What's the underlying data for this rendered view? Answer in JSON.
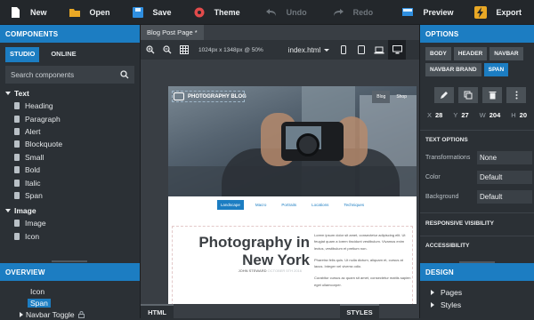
{
  "toolbar": {
    "new": "New",
    "open": "Open",
    "save": "Save",
    "theme": "Theme",
    "undo": "Undo",
    "redo": "Redo",
    "preview": "Preview",
    "export": "Export"
  },
  "components": {
    "header": "COMPONENTS",
    "tabs": [
      "STUDIO",
      "ONLINE"
    ],
    "search_placeholder": "Search components",
    "categories": [
      {
        "name": "Text",
        "items": [
          "Heading",
          "Paragraph",
          "Alert",
          "Blockquote",
          "Small",
          "Bold",
          "Italic",
          "Span"
        ]
      },
      {
        "name": "Image",
        "items": [
          "Image",
          "Icon"
        ]
      }
    ]
  },
  "overview": {
    "header": "OVERVIEW",
    "items": [
      "Icon",
      "Span",
      "Navbar Toggle"
    ]
  },
  "center": {
    "page_tab": "Blog Post Page *",
    "dimensions": "1024px x 1348px @ 50%",
    "file": "index.html",
    "bottom_html": "HTML",
    "bottom_styles": "STYLES"
  },
  "preview": {
    "brand": "PHOTOGRAPHY BLOG",
    "nav": [
      "Blog",
      "Shop"
    ],
    "subnav": [
      "Landscape",
      "Macro",
      "Portraits",
      "Locations",
      "Techniques"
    ],
    "title_line1": "Photography in",
    "title_line2": "New York",
    "author": "JOHN STEWARD",
    "date": "OCTOBER 5TH 2016",
    "body": [
      "Lorem ipsum dolor sit amet, consectetur adipiscing elit. Ut feugiat quam a lorem tincidunt vestibulum. Vivamus enim lectus, vestibulum et pretium non.",
      "Pharetra felis quis. Ut nulla dictum, aliquam et, cursus at lacus. Integer vel viverra odio.",
      "Curabitur cursus ac quam sit amet, consectetur mattis sapien eget ullamcorper."
    ]
  },
  "options": {
    "header": "OPTIONS",
    "tags": [
      "BODY",
      "HEADER",
      "NAVBAR",
      "NAVBAR BRAND",
      "SPAN"
    ],
    "x": "28",
    "y": "27",
    "w": "204",
    "h": "20",
    "text_options_label": "TEXT OPTIONS",
    "transformations_label": "Transformations",
    "transformations_value": "None",
    "color_label": "Color",
    "color_value": "Default",
    "background_label": "Background",
    "background_value": "Default",
    "responsive_label": "RESPONSIVE VISIBILITY",
    "accessibility_label": "ACCESSIBILITY"
  },
  "design": {
    "header": "DESIGN",
    "items": [
      "Pages",
      "Styles"
    ]
  },
  "colors": {
    "accent": "#1c7dc2",
    "panel": "#2b3035",
    "toolbar": "#23272b"
  }
}
